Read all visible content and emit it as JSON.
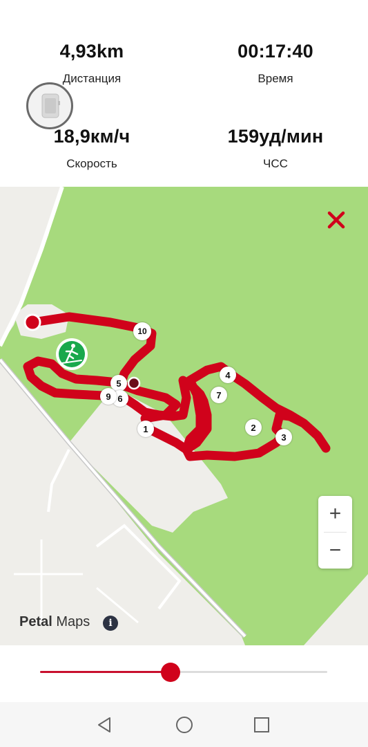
{
  "stats": {
    "distance": {
      "value": "4,93km",
      "label": "Дистанция"
    },
    "time": {
      "value": "00:17:40",
      "label": "Время"
    },
    "speed": {
      "value": "18,9км/ч",
      "label": "Скорость"
    },
    "heart_rate": {
      "value": "159уд/мин",
      "label": "ЧСС"
    }
  },
  "map": {
    "provider_brand": "Petal",
    "provider_word": "Maps",
    "info_glyph": "i",
    "zoom_in": "+",
    "zoom_out": "−",
    "route_color": "#d0021b",
    "water_color": "#a7da7d",
    "start_marker_icon": "cross-country-ski-icon",
    "start_marker_color": "#19a84c",
    "lap_markers": [
      "1",
      "2",
      "3",
      "4",
      "5",
      "6",
      "7",
      "9",
      "10"
    ]
  },
  "playback": {
    "progress": 0.455,
    "accent": "#d0021b"
  },
  "nav": {
    "back_icon": "back-triangle-icon",
    "home_icon": "home-circle-icon",
    "recents_icon": "recents-square-icon"
  }
}
